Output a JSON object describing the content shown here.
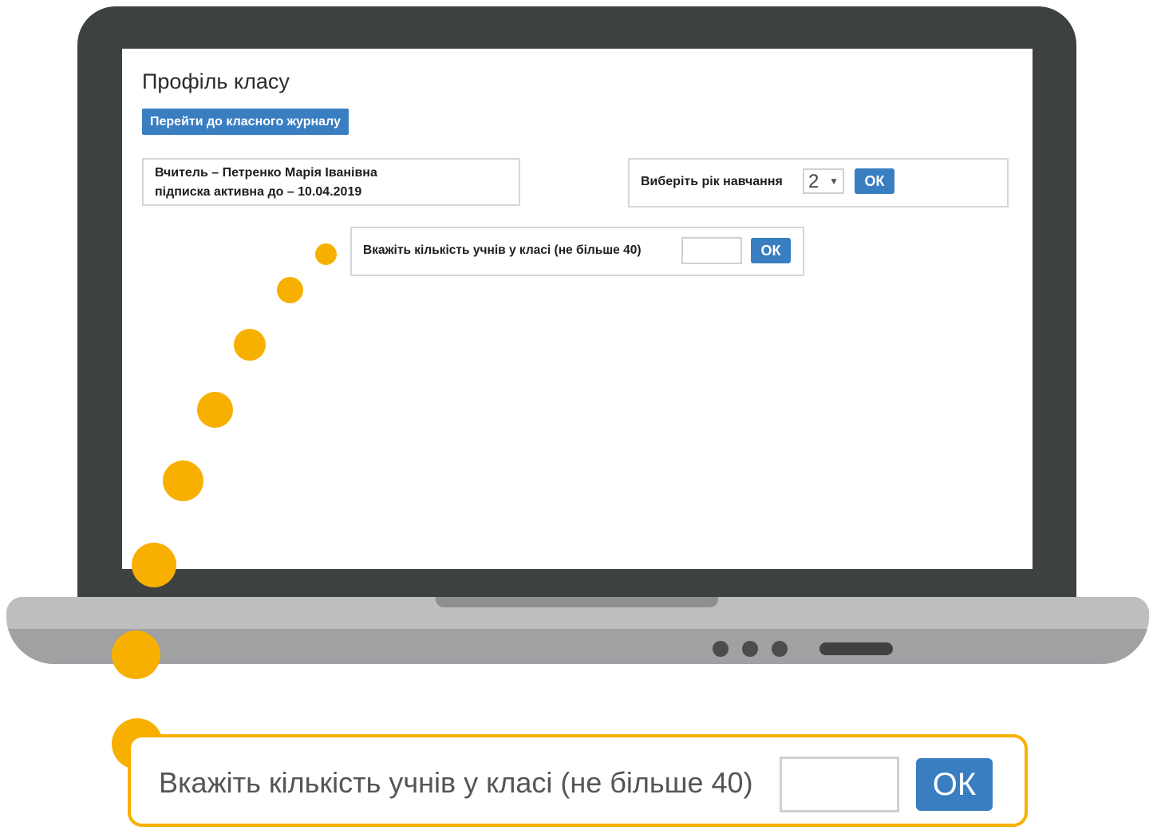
{
  "page": {
    "title": "Профіль класу",
    "journal_button": "Перейти до класного журналу"
  },
  "teacher": {
    "line1": "Вчитель – Петренко Марія Іванівна",
    "line2": "підписка активна до – 10.04.2019"
  },
  "year": {
    "label": "Виберіть рік навчання",
    "selected": "2",
    "ok_label": "ОК"
  },
  "students": {
    "label": "Вкажіть кількість учнів у класі (не більше 40)",
    "value": "",
    "ok_label": "ОК"
  },
  "callout": {
    "label": "Вкажіть кількість учнів у класі (не більше 40)",
    "value": "",
    "ok_label": "ОК"
  },
  "colors": {
    "accent": "#3a7ec2",
    "highlight": "#f8b000",
    "laptop_frame": "#3e4142"
  }
}
